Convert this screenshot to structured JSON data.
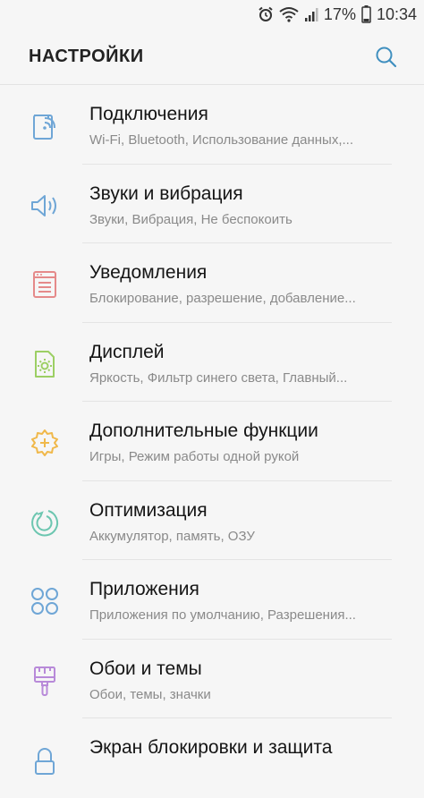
{
  "status_bar": {
    "battery_percent": "17%",
    "time": "10:34",
    "icons": [
      "alarm-icon",
      "wifi-icon",
      "signal-icon",
      "battery-icon"
    ]
  },
  "header": {
    "title": "НАСТРОЙКИ",
    "search_icon": "search-icon"
  },
  "colors": {
    "background": "#f6f6f6",
    "icon_blue": "#6fa6d6",
    "icon_red": "#e58a8a",
    "icon_green": "#9ccf64",
    "icon_yellow": "#f0b84a",
    "icon_teal": "#6cc6b0",
    "icon_purple": "#b88ad9",
    "search_color": "#3f8fbf"
  },
  "settings": [
    {
      "title": "Подключения",
      "subtitle": "Wi-Fi, Bluetooth, Использование данных,...",
      "icon": "connections-icon"
    },
    {
      "title": "Звуки и вибрация",
      "subtitle": "Звуки, Вибрация, Не беспокоить",
      "icon": "sound-icon"
    },
    {
      "title": "Уведомления",
      "subtitle": "Блокирование, разрешение, добавление...",
      "icon": "notifications-icon"
    },
    {
      "title": "Дисплей",
      "subtitle": "Яркость, Фильтр синего света, Главный...",
      "icon": "display-icon"
    },
    {
      "title": "Дополнительные функции",
      "subtitle": "Игры, Режим работы одной рукой",
      "icon": "advanced-features-icon"
    },
    {
      "title": "Оптимизация",
      "subtitle": "Аккумулятор, память, ОЗУ",
      "icon": "optimization-icon"
    },
    {
      "title": "Приложения",
      "subtitle": "Приложения по умолчанию, Разрешения...",
      "icon": "apps-icon"
    },
    {
      "title": "Обои и темы",
      "subtitle": "Обои, темы, значки",
      "icon": "wallpapers-icon"
    },
    {
      "title": "Экран блокировки и защита",
      "subtitle": "",
      "icon": "lock-screen-icon"
    }
  ]
}
